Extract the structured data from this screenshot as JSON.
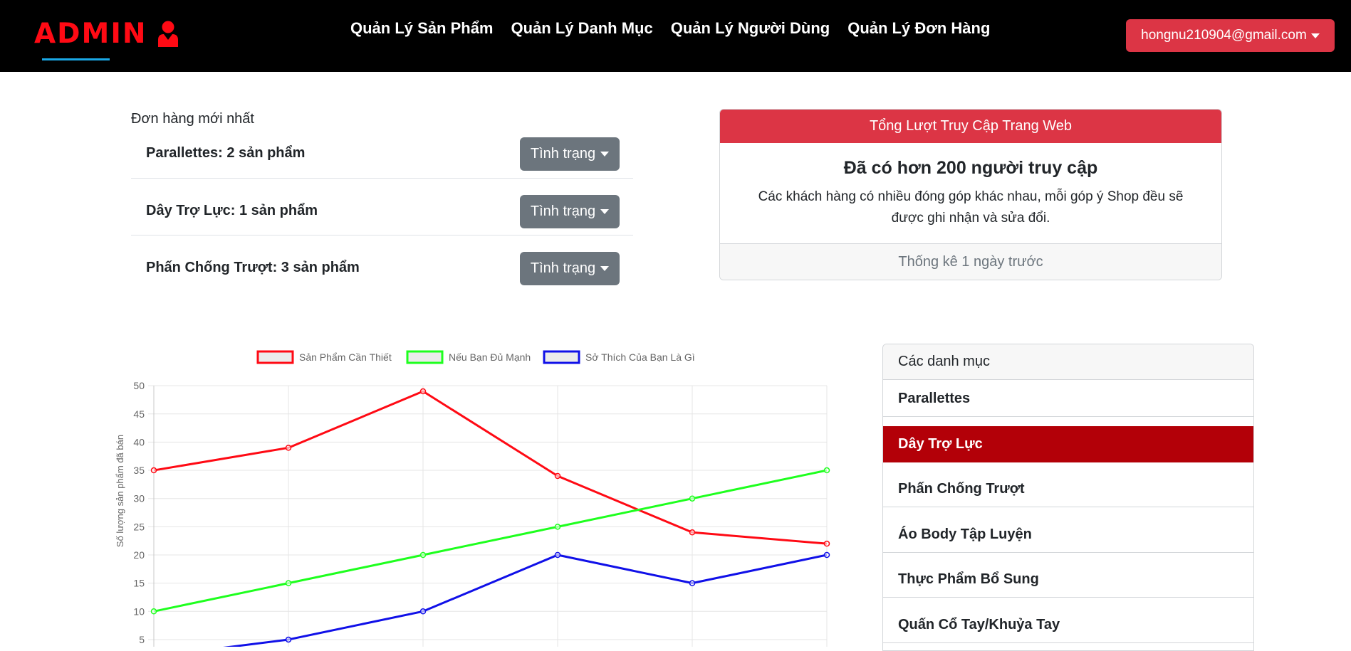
{
  "navbar": {
    "brand": "ADMIN",
    "brand_icon": "user-icon",
    "links": [
      "Quản Lý Sản Phẩm",
      "Quản Lý Danh Mục",
      "Quản Lý Người Dùng",
      "Quản Lý Đơn Hàng"
    ],
    "user_email": "hongnu210904@gmail.com"
  },
  "orders": {
    "title": "Đơn hàng mới nhất",
    "items": [
      {
        "name": "Parallettes: 2 sản phẩm",
        "status_label": "Tình trạng"
      },
      {
        "name": "Dây Trợ Lực: 1 sản phẩm",
        "status_label": "Tình trạng"
      },
      {
        "name": "Phấn Chống Trượt: 3 sản phẩm",
        "status_label": "Tình trạng"
      }
    ]
  },
  "visits": {
    "header": "Tổng Lượt Truy Cập Trang Web",
    "title": "Đã có hơn 200 người truy cập",
    "text": "Các khách hàng có nhiều đóng góp khác nhau, mỗi góp ý Shop đều sẽ được ghi nhận và sửa đổi.",
    "footer": "Thống kê 1 ngày trước"
  },
  "categories": {
    "header": "Các danh mục",
    "active_index": 1,
    "items": [
      "Parallettes",
      "Dây Trợ Lực",
      "Phấn Chống Trượt",
      "Áo Body Tập Luyện",
      "Thực Phẩm Bổ Sung",
      "Quấn Cổ Tay/Khuỷa Tay"
    ]
  },
  "colors": {
    "navbar": "#000000",
    "brand": "#ff0a14",
    "danger": "#dc3545",
    "secondary": "#6c757d",
    "active_category": "#b30008"
  },
  "chart_data": {
    "type": "line",
    "title": "",
    "xlabel": "",
    "ylabel": "Số lượng sản phẩm đã bán",
    "ylim": [
      0,
      50
    ],
    "yticks": [
      5,
      10,
      15,
      20,
      25,
      30,
      35,
      40,
      45,
      50
    ],
    "legend_position": "top",
    "grid": true,
    "series": [
      {
        "name": "Sản Phẩm Cần Thiết",
        "color": "#ff0a14",
        "values": [
          35,
          39,
          49,
          34,
          24,
          22
        ]
      },
      {
        "name": "Nếu Bạn Đủ Mạnh",
        "color": "#1eff1e",
        "values": [
          10,
          15,
          20,
          25,
          30,
          35
        ]
      },
      {
        "name": "Sở Thích Của Bạn Là Gì",
        "color": "#1010e8",
        "values": [
          2,
          5,
          10,
          20,
          15,
          20
        ]
      }
    ]
  }
}
